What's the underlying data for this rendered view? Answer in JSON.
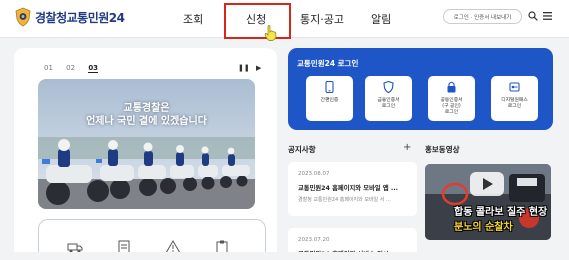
{
  "header": {
    "logo_part1": "경찰청",
    "logo_part2": "교통민원24",
    "nav": [
      "조회",
      "신청",
      "통지·공고",
      "알림"
    ],
    "login_pill": "로그인 · 인증서 내보내기"
  },
  "banner": {
    "slides": [
      "01",
      "02",
      "03"
    ],
    "current_slide": "03",
    "line1": "교통경찰은",
    "line2": "언제나 국민 곁에 있겠습니다"
  },
  "login": {
    "title": "교통민원24 로그인",
    "options": [
      {
        "label": "간편인증",
        "icon": "phone-icon"
      },
      {
        "label": "금융인증서\n로그인",
        "icon": "shield-icon"
      },
      {
        "label": "공동인증서\n(구 공인)\n로그인",
        "icon": "lock-icon"
      },
      {
        "label": "디지털원패스\n로그인",
        "icon": "key-icon"
      }
    ]
  },
  "notices": {
    "heading": "공지사항",
    "more": "+",
    "items": [
      {
        "date": "2023.08.07",
        "title": "교통민원24 홈페이지와 모바일 앱 ...",
        "desc": "경찰청 교통민원24 홈페이지와 모바일 서 ..."
      },
      {
        "date": "2023.07.20",
        "title": "교통민원24 홈페이지 서비스 일시 ..."
      }
    ]
  },
  "video": {
    "heading": "홍보동영상",
    "caption1": "합동 콜라보 질주 현장",
    "caption2": "분노의 순찰차"
  },
  "colors": {
    "brand_blue": "#1e56c8",
    "highlight_red": "#d9261c"
  }
}
